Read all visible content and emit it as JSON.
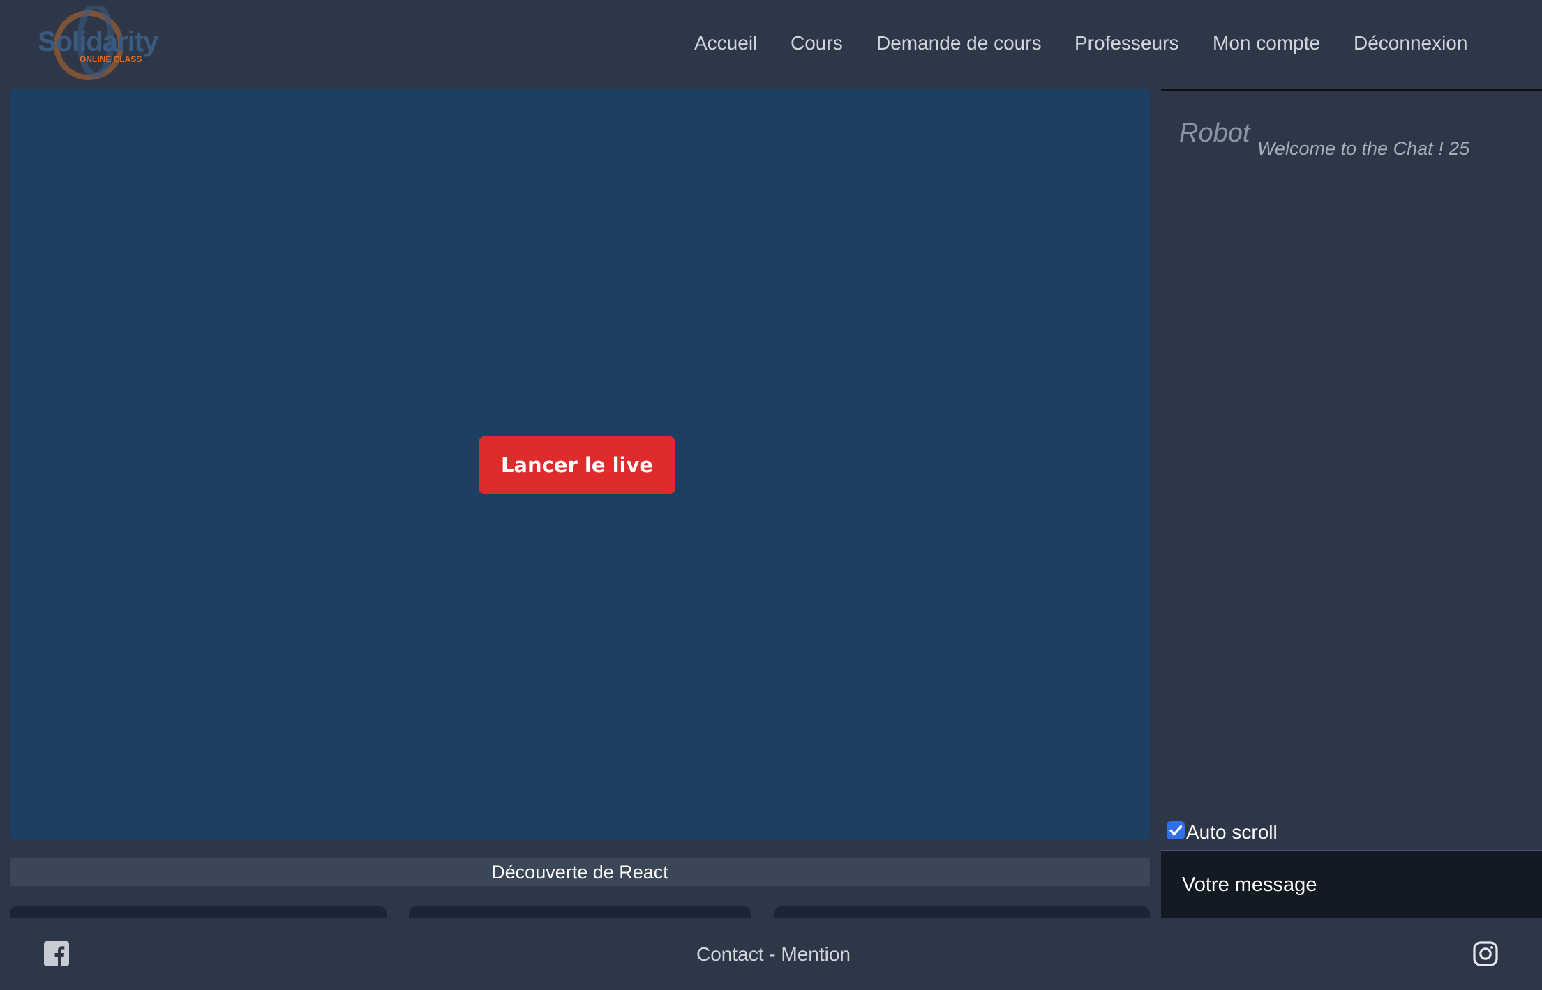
{
  "header": {
    "logo": {
      "name": "Solidarity",
      "tagline": "ONLINE CLASS"
    },
    "nav": [
      {
        "label": "Accueil"
      },
      {
        "label": "Cours"
      },
      {
        "label": "Demande de cours"
      },
      {
        "label": "Professeurs"
      },
      {
        "label": "Mon compte"
      },
      {
        "label": "Déconnexion"
      }
    ]
  },
  "video": {
    "launch_button_label": "Lancer le live",
    "course_title": "Découverte de React"
  },
  "chat": {
    "messages": [
      {
        "author": "Robot",
        "text": "Welcome to the Chat ! 25"
      }
    ],
    "autoscroll": {
      "label": "Auto scroll",
      "checked": true
    },
    "input_placeholder": "Votre message"
  },
  "footer": {
    "contact_label": "Contact",
    "separator": " - ",
    "mention_label": "Mention",
    "icons": [
      "facebook-icon",
      "instagram-icon"
    ]
  },
  "colors": {
    "background": "#2d3748",
    "video_background": "#1d3f64",
    "accent_red": "#dd2b2e",
    "logo_blue": "#3a5a80",
    "logo_orange": "#e86b1f",
    "input_background": "#131a24"
  }
}
